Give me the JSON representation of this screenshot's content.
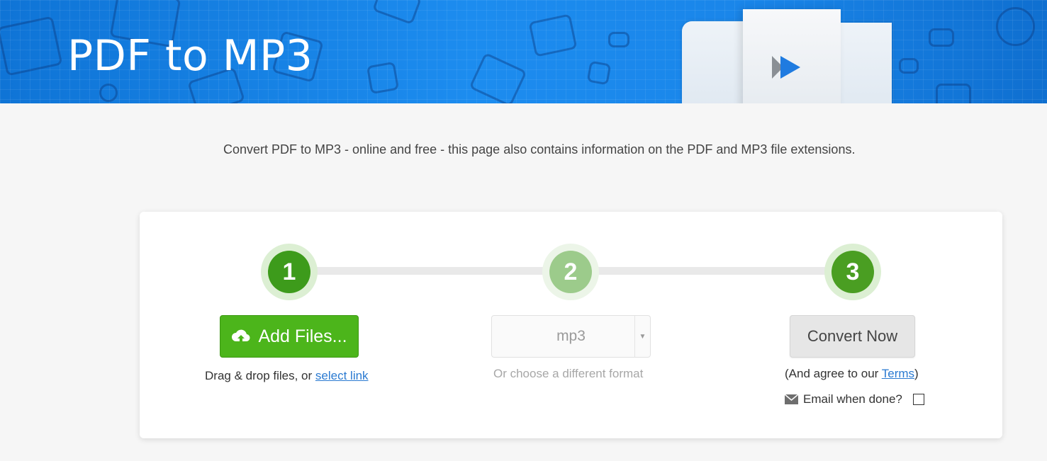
{
  "header": {
    "title": "PDF to MP3"
  },
  "intro": {
    "text": "Convert PDF to MP3 - online and free - this page also contains information on the PDF and MP3 file extensions."
  },
  "steps": [
    {
      "number": "1",
      "color": "#3d9b1b"
    },
    {
      "number": "2",
      "color": "#9ccb8b"
    },
    {
      "number": "3",
      "color": "#4a9e22"
    }
  ],
  "add_files": {
    "label": "Add Files...",
    "hint_prefix": "Drag & drop files, or ",
    "hint_link": "select link"
  },
  "format": {
    "selected": "mp3",
    "hint": "Or choose a different format"
  },
  "convert": {
    "label": "Convert Now",
    "terms_prefix": "(And agree to our ",
    "terms_link": "Terms",
    "terms_suffix": ")",
    "email_label": "Email when done?"
  },
  "icons": {
    "upload": "cloud-upload-icon",
    "email": "envelope-icon",
    "play": "play-icon"
  },
  "colors": {
    "brand_blue": "#1a86ea",
    "add_green": "#4cb51b",
    "link_blue": "#2a7ad1"
  }
}
